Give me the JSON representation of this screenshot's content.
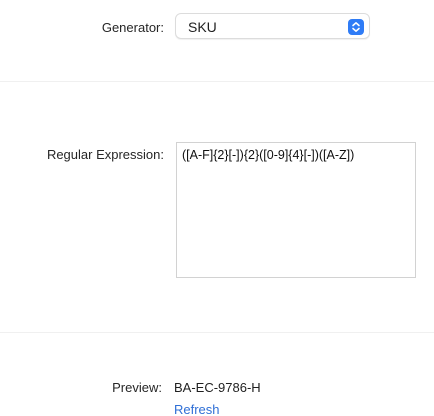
{
  "generator": {
    "label": "Generator:",
    "selected": "SKU"
  },
  "regex": {
    "label": "Regular Expression:",
    "value": "([A-F]{2}[-]){2}([0-9]{4}[-])([A-Z])"
  },
  "preview": {
    "label": "Preview:",
    "value": "BA-EC-9786-H",
    "refresh_label": "Refresh"
  },
  "colors": {
    "accent": "#2f7cf6",
    "link": "#2f6fd6"
  },
  "icons": {
    "popup_arrows": "chevron-up-down-icon"
  }
}
